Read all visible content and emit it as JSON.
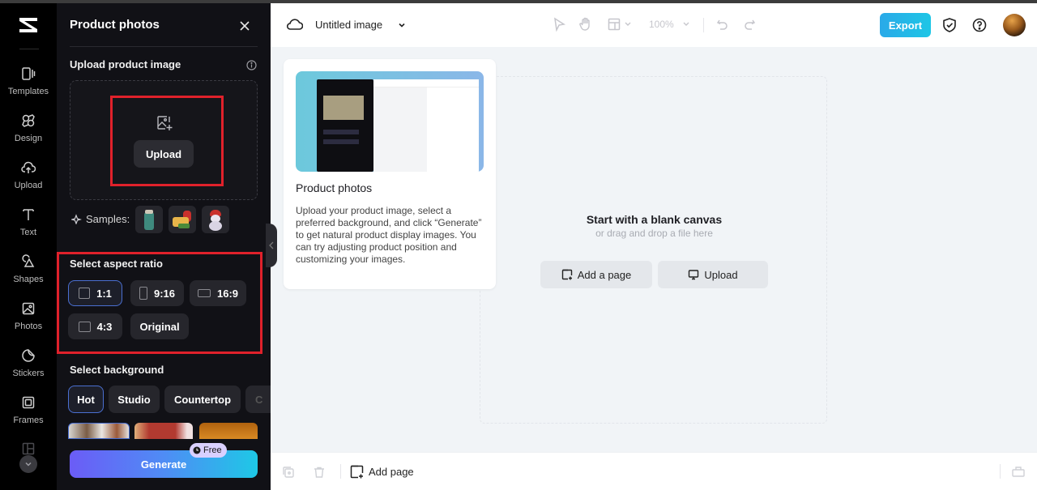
{
  "rail": {
    "items": [
      {
        "label": "Templates",
        "icon": "templates-icon"
      },
      {
        "label": "Design",
        "icon": "design-icon"
      },
      {
        "label": "Upload",
        "icon": "upload-cloud-icon"
      },
      {
        "label": "Text",
        "icon": "text-icon"
      },
      {
        "label": "Shapes",
        "icon": "shapes-icon"
      },
      {
        "label": "Photos",
        "icon": "photos-icon"
      },
      {
        "label": "Stickers",
        "icon": "stickers-icon"
      },
      {
        "label": "Frames",
        "icon": "frames-icon"
      }
    ]
  },
  "panel": {
    "title": "Product photos",
    "upload_section_label": "Upload product image",
    "upload_button": "Upload",
    "samples_label": "Samples:",
    "samples": [
      "sample-thermos",
      "sample-gift-food",
      "sample-snowman"
    ],
    "aspect_label": "Select aspect ratio",
    "aspect_ratios": [
      {
        "label": "1:1",
        "selected": true
      },
      {
        "label": "9:16",
        "selected": false
      },
      {
        "label": "16:9",
        "selected": false
      },
      {
        "label": "4:3",
        "selected": false
      },
      {
        "label": "Original",
        "selected": false
      }
    ],
    "background_label": "Select background",
    "background_tabs": [
      {
        "label": "Hot",
        "selected": true
      },
      {
        "label": "Studio",
        "selected": false
      },
      {
        "label": "Countertop",
        "selected": false
      },
      {
        "label": "C",
        "selected": false
      }
    ],
    "generate_button": "Generate",
    "free_badge": "Free"
  },
  "topbar": {
    "doc_title": "Untitled image",
    "zoom": "100%",
    "export_button": "Export"
  },
  "tip_card": {
    "title": "Product photos",
    "description": "Upload your product image, select a preferred background, and click “Generate” to get natural product display images. You can try adjusting product position and customizing your images."
  },
  "canvas": {
    "title": "Start with a blank canvas",
    "subtitle": "or drag and drop a file here",
    "add_page_button": "Add a page",
    "upload_button": "Upload"
  },
  "bottombar": {
    "add_page": "Add page"
  },
  "colors": {
    "accent_export": "#1ec6e6",
    "highlight_red": "#e0212b",
    "selected_border": "#4a6fd1",
    "panel_bg": "#111116"
  }
}
